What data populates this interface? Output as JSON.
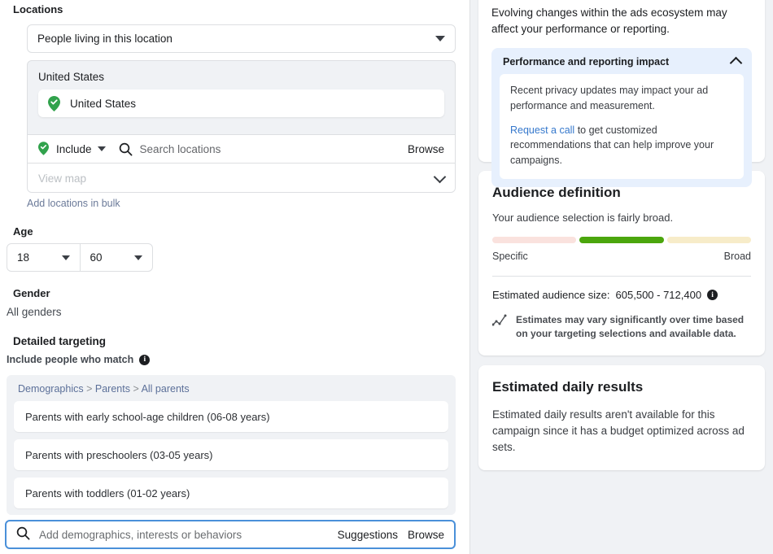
{
  "locations": {
    "section_label": "Locations",
    "location_type": {
      "value": "People living in this location",
      "caret_icon": "chevron-down-icon"
    },
    "country_group_title": "United States",
    "selected": [
      {
        "name": "United States",
        "icon": "location-pin-check-icon"
      }
    ],
    "actions": {
      "include_label": "Include",
      "include_icon": "location-pin-check-icon",
      "include_caret_icon": "chevron-down-icon",
      "search_icon": "search-icon",
      "search_placeholder": "Search locations",
      "browse_label": "Browse"
    },
    "view_map": {
      "label": "View map",
      "chevron_icon": "chevron-down-icon"
    },
    "bulk_link": "Add locations in bulk"
  },
  "age": {
    "label": "Age",
    "min": "18",
    "max": "60",
    "caret_icon": "chevron-down-icon"
  },
  "gender": {
    "label": "Gender",
    "value": "All genders"
  },
  "detailed_targeting": {
    "label": "Detailed targeting",
    "include_label": "Include people who match",
    "info_icon": "info-icon",
    "info_glyph": "i",
    "breadcrumb": {
      "parts": [
        "Demographics",
        "Parents",
        "All parents"
      ],
      "separator": ">"
    },
    "items": [
      "Parents with early school-age children (06-08 years)",
      "Parents with preschoolers (03-05 years)",
      "Parents with toddlers (01-02 years)"
    ],
    "search": {
      "icon": "search-icon",
      "placeholder": "Add demographics, interests or behaviors",
      "suggestions_label": "Suggestions",
      "browse_label": "Browse",
      "focus_color": "#4a90d9"
    }
  },
  "sidebar": {
    "ecosystem_notice": "Evolving changes within the ads ecosystem may affect your performance or reporting.",
    "impact": {
      "title": "Performance and reporting impact",
      "collapse_icon": "chevron-up-icon",
      "paragraph_1": "Recent privacy updates may impact your ad performance and measurement.",
      "link_text": "Request a call",
      "paragraph_2_rest": " to get customized recommendations that can help improve your campaigns.",
      "background": "#e7f0fd"
    },
    "audience_definition": {
      "title": "Audience definition",
      "subtitle": "Your audience selection is fairly broad.",
      "meter": {
        "segments": [
          {
            "name": "specific",
            "color": "#fae2de",
            "active": false
          },
          {
            "name": "middle",
            "color": "#4ba60d",
            "active": true
          },
          {
            "name": "broad",
            "color": "#f7ecc9",
            "active": false
          }
        ],
        "left_label": "Specific",
        "right_label": "Broad"
      },
      "estimated_size_label": "Estimated audience size:",
      "estimated_size_value": "605,500 - 712,400",
      "info_icon": "info-icon",
      "info_glyph": "i",
      "note_icon": "trend-chart-icon",
      "note": "Estimates may vary significantly over time based on your targeting selections and available data."
    },
    "estimated_daily_results": {
      "title": "Estimated daily results",
      "body": "Estimated daily results aren't available for this campaign since it has a budget optimized across ad sets."
    }
  }
}
